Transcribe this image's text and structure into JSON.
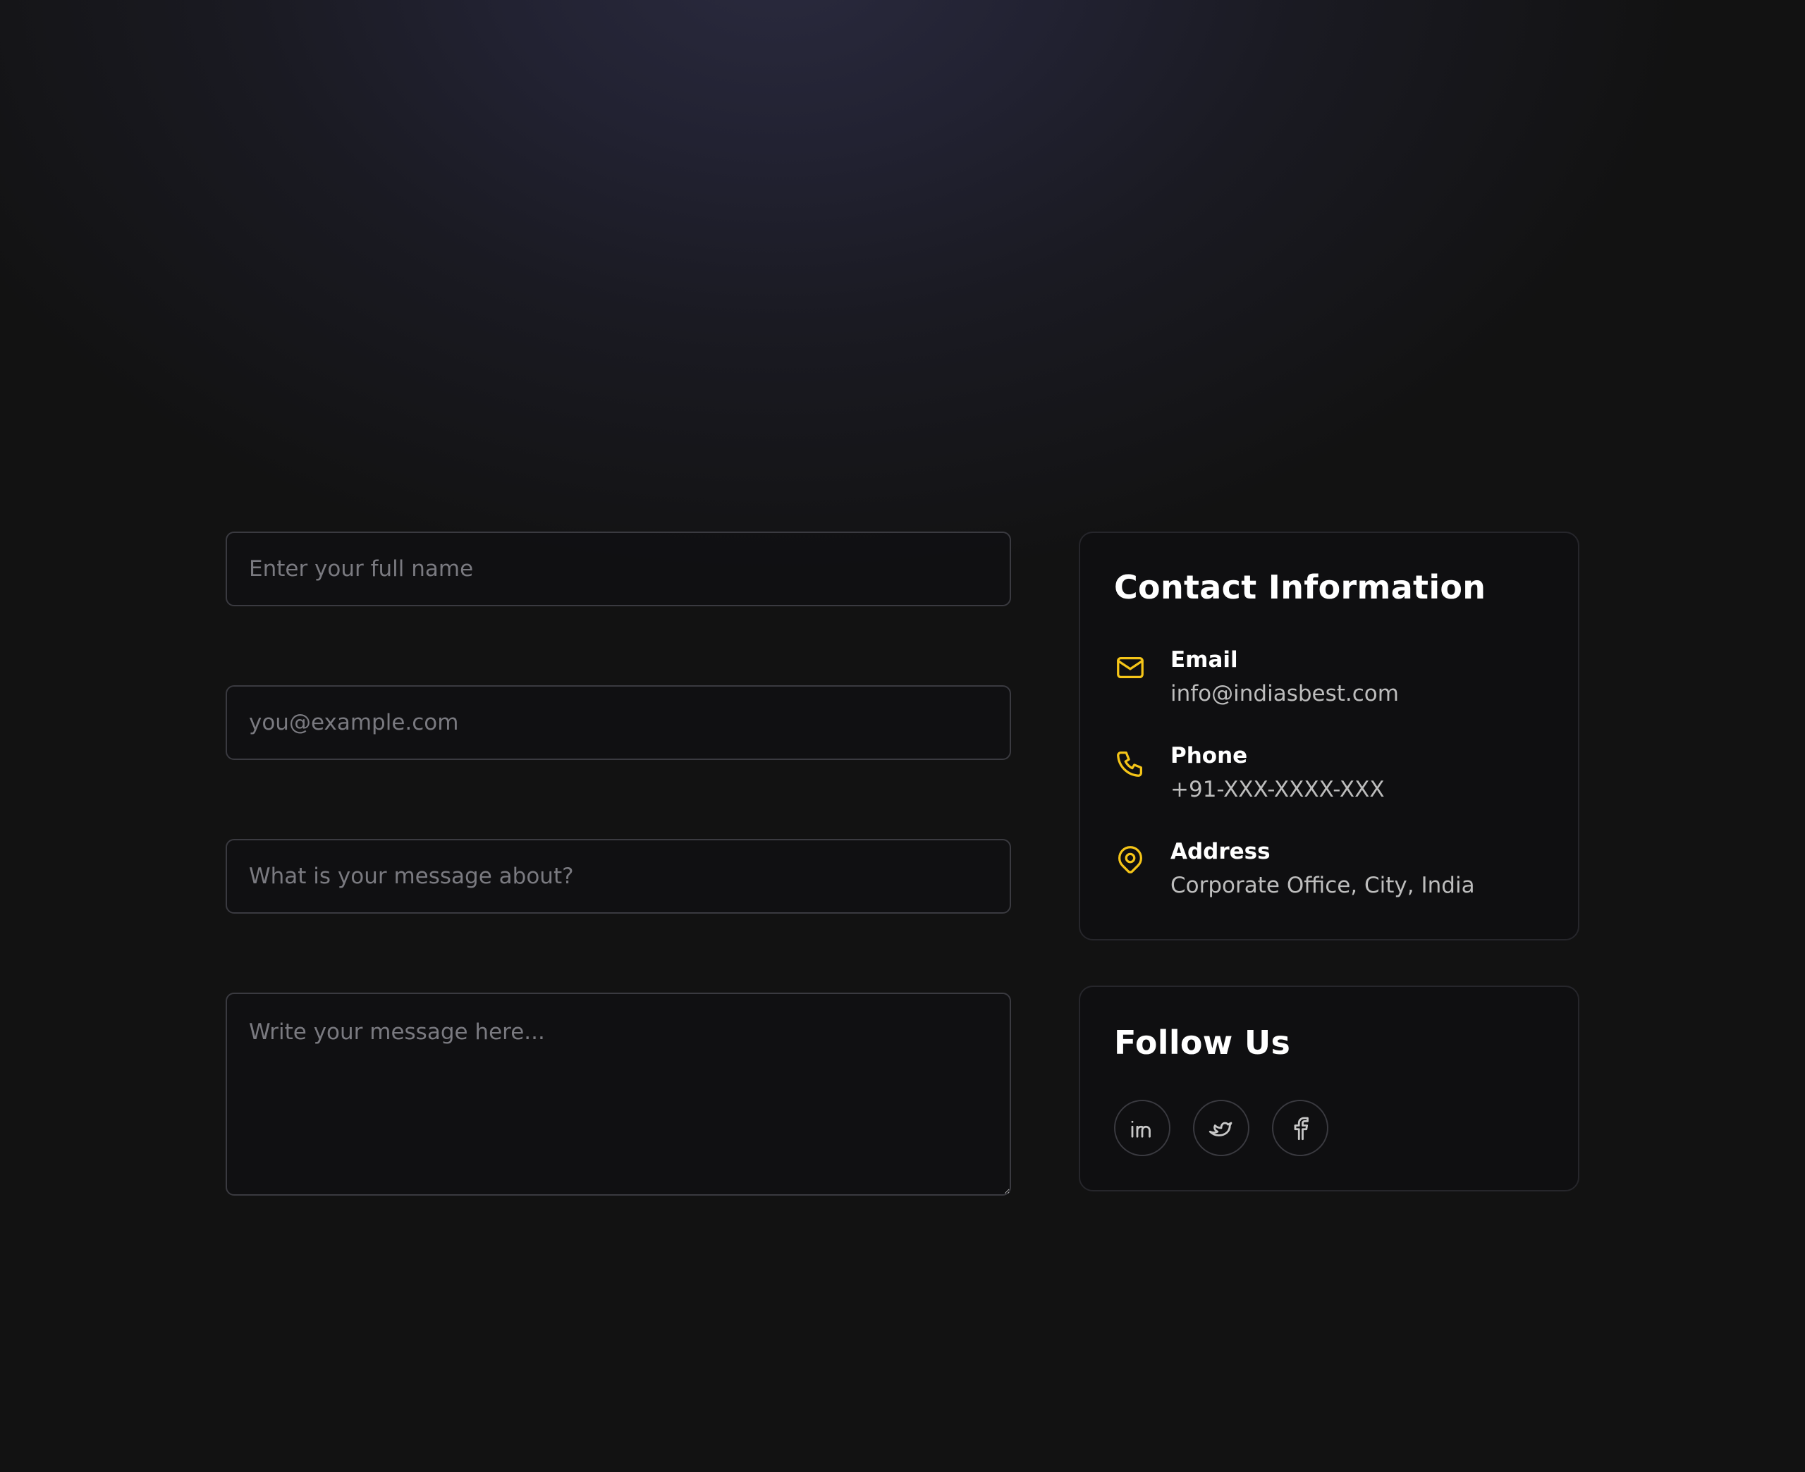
{
  "form": {
    "name_placeholder": "Enter your full name",
    "email_placeholder": "you@example.com",
    "subject_placeholder": "What is your message about?",
    "message_placeholder": "Write your message here..."
  },
  "contact": {
    "title": "Contact Information",
    "items": [
      {
        "icon": "mail-icon",
        "label": "Email",
        "value": "info@indiasbest.com"
      },
      {
        "icon": "phone-icon",
        "label": "Phone",
        "value": "+91-XXX-XXXX-XXX"
      },
      {
        "icon": "map-pin-icon",
        "label": "Address",
        "value": "Corporate Office, City, India"
      }
    ]
  },
  "follow": {
    "title": "Follow Us",
    "socials": [
      "linkedin-icon",
      "twitter-icon",
      "facebook-icon"
    ]
  },
  "colors": {
    "accent": "#f5c518",
    "background": "#121212",
    "card_border": "#26262b",
    "text_primary": "#ffffff",
    "text_secondary": "#bdbdbd",
    "placeholder": "#7a7a80"
  }
}
